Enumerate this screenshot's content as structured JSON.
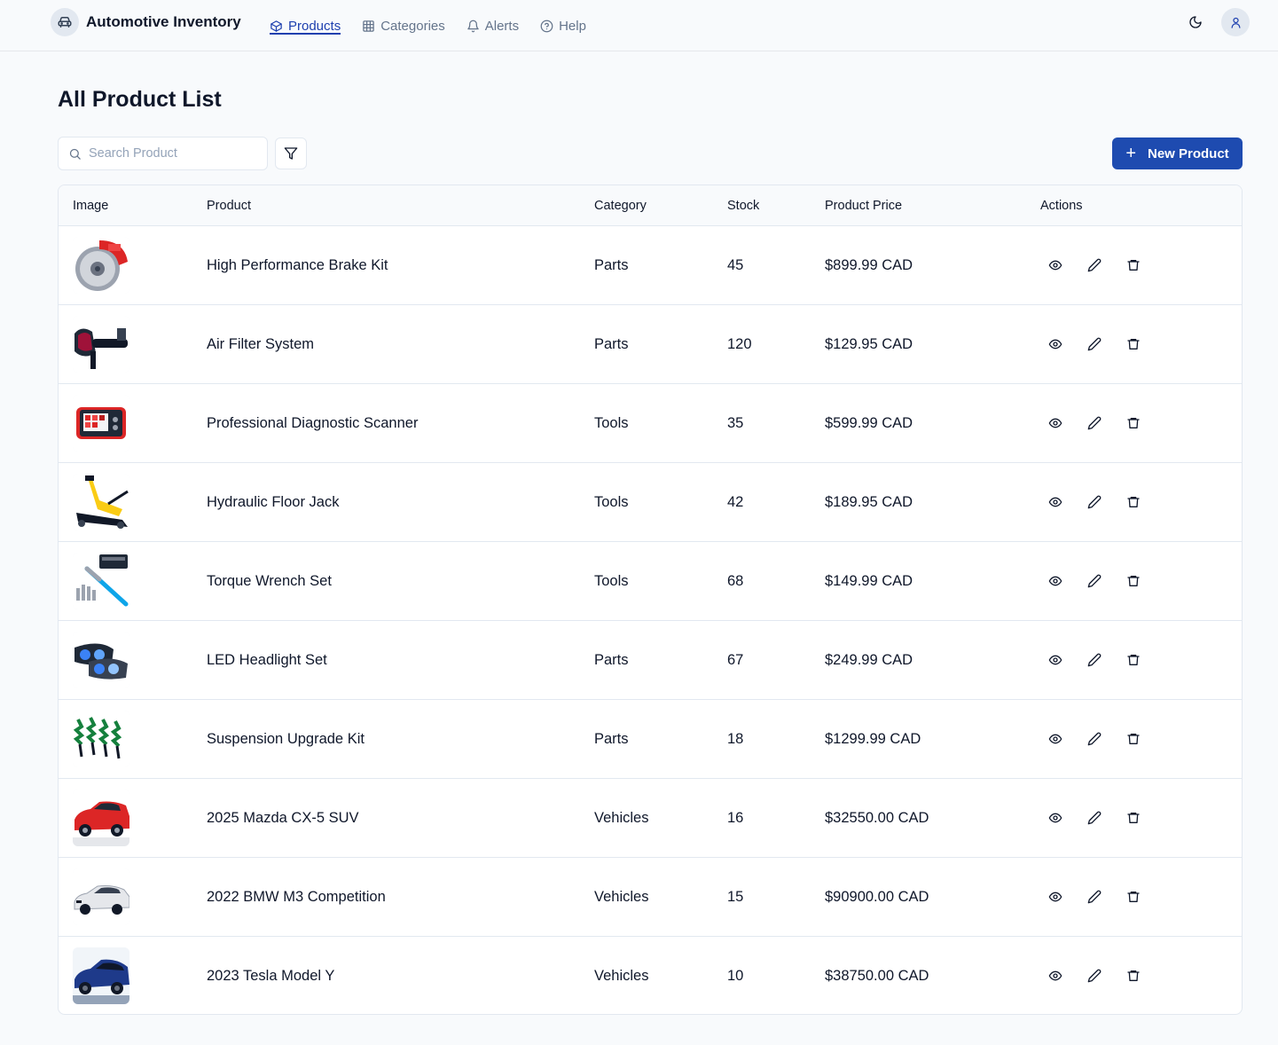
{
  "header": {
    "brand": "Automotive Inventory",
    "nav": [
      {
        "label": "Products",
        "icon": "box-icon",
        "active": true
      },
      {
        "label": "Categories",
        "icon": "grid-icon",
        "active": false
      },
      {
        "label": "Alerts",
        "icon": "bell-icon",
        "active": false
      },
      {
        "label": "Help",
        "icon": "help-circle-icon",
        "active": false
      }
    ]
  },
  "main": {
    "title": "All Product List",
    "search_placeholder": "Search Product",
    "new_button": "New Product"
  },
  "table": {
    "columns": [
      "Image",
      "Product",
      "Category",
      "Stock",
      "Product Price",
      "Actions"
    ],
    "rows": [
      {
        "product": "High Performance Brake Kit",
        "category": "Parts",
        "stock": "45",
        "price": "$899.99 CAD"
      },
      {
        "product": "Air Filter System",
        "category": "Parts",
        "stock": "120",
        "price": "$129.95 CAD"
      },
      {
        "product": "Professional Diagnostic Scanner",
        "category": "Tools",
        "stock": "35",
        "price": "$599.99 CAD"
      },
      {
        "product": "Hydraulic Floor Jack",
        "category": "Tools",
        "stock": "42",
        "price": "$189.95 CAD"
      },
      {
        "product": "Torque Wrench Set",
        "category": "Tools",
        "stock": "68",
        "price": "$149.99 CAD"
      },
      {
        "product": "LED Headlight Set",
        "category": "Parts",
        "stock": "67",
        "price": "$249.99 CAD"
      },
      {
        "product": "Suspension Upgrade Kit",
        "category": "Parts",
        "stock": "18",
        "price": "$1299.99 CAD"
      },
      {
        "product": "2025 Mazda CX-5 SUV",
        "category": "Vehicles",
        "stock": "16",
        "price": "$32550.00 CAD"
      },
      {
        "product": "2022 BMW M3 Competition",
        "category": "Vehicles",
        "stock": "15",
        "price": "$90900.00 CAD"
      },
      {
        "product": "2023 Tesla Model Y",
        "category": "Vehicles",
        "stock": "10",
        "price": "$38750.00 CAD"
      }
    ]
  },
  "colors": {
    "accent": "#1e4bb0",
    "nav_active": "#1e40af",
    "background": "#f8fafc"
  }
}
